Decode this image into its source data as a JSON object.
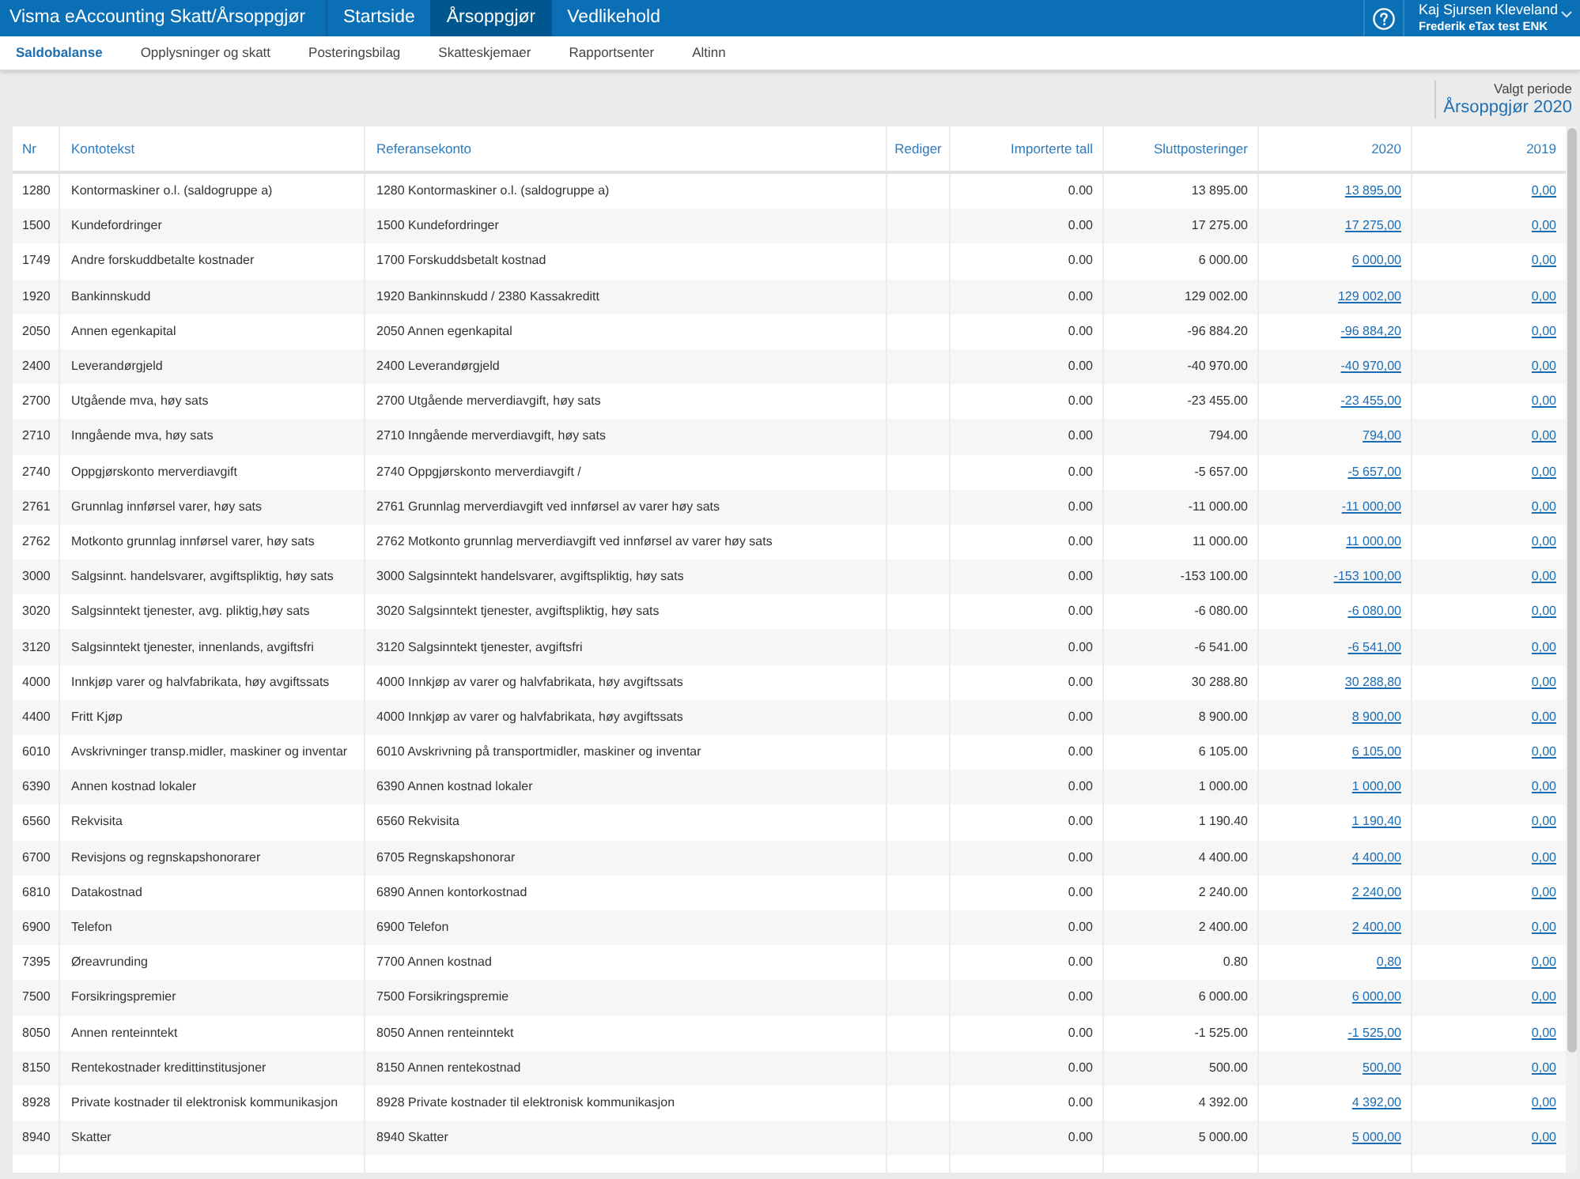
{
  "app_bar": {
    "title": "Visma eAccounting Skatt/Årsoppgjør",
    "nav": [
      {
        "label": "Startside",
        "selected": false
      },
      {
        "label": "Årsoppgjør",
        "selected": true
      },
      {
        "label": "Vedlikehold",
        "selected": false
      }
    ],
    "user": {
      "name": "Kaj Sjursen Kleveland",
      "company": "Frederik eTax test ENK"
    }
  },
  "sub_nav": [
    {
      "label": "Saldobalanse",
      "selected": true
    },
    {
      "label": "Opplysninger og skatt",
      "selected": false
    },
    {
      "label": "Posteringsbilag",
      "selected": false
    },
    {
      "label": "Skatteskjemaer",
      "selected": false
    },
    {
      "label": "Rapportsenter",
      "selected": false
    },
    {
      "label": "Altinn",
      "selected": false
    }
  ],
  "period": {
    "label": "Valgt periode",
    "value": "Årsoppgjør 2020"
  },
  "table": {
    "columns": [
      "Nr",
      "Kontotekst",
      "Referansekonto",
      "Rediger",
      "Importerte tall",
      "Sluttposteringer",
      "2020",
      "2019"
    ],
    "rows": [
      {
        "nr": "1280",
        "account_text": "Kontormaskiner o.l. (saldogruppe a)",
        "reference_account": "1280 Kontormaskiner o.l. (saldogruppe a)",
        "imported": "0.00",
        "final_entries": "13 895.00",
        "amount_2020": "13 895,00",
        "amount_2019": "0,00"
      },
      {
        "nr": "1500",
        "account_text": "Kundefordringer",
        "reference_account": "1500 Kundefordringer",
        "imported": "0.00",
        "final_entries": "17 275.00",
        "amount_2020": "17 275,00",
        "amount_2019": "0,00"
      },
      {
        "nr": "1749",
        "account_text": "Andre forskuddbetalte kostnader",
        "reference_account": "1700 Forskuddsbetalt kostnad",
        "imported": "0.00",
        "final_entries": "6 000.00",
        "amount_2020": "6 000,00",
        "amount_2019": "0,00"
      },
      {
        "nr": "1920",
        "account_text": "Bankinnskudd",
        "reference_account": "1920 Bankinnskudd / 2380 Kassakreditt",
        "imported": "0.00",
        "final_entries": "129 002.00",
        "amount_2020": "129 002,00",
        "amount_2019": "0,00"
      },
      {
        "nr": "2050",
        "account_text": "Annen egenkapital",
        "reference_account": "2050 Annen egenkapital",
        "imported": "0.00",
        "final_entries": "-96 884.20",
        "amount_2020": "-96 884,20",
        "amount_2019": "0,00"
      },
      {
        "nr": "2400",
        "account_text": "Leverandørgjeld",
        "reference_account": "2400 Leverandørgjeld",
        "imported": "0.00",
        "final_entries": "-40 970.00",
        "amount_2020": "-40 970,00",
        "amount_2019": "0,00"
      },
      {
        "nr": "2700",
        "account_text": "Utgående mva, høy sats",
        "reference_account": "2700 Utgående merverdiavgift, høy sats",
        "imported": "0.00",
        "final_entries": "-23 455.00",
        "amount_2020": "-23 455,00",
        "amount_2019": "0,00"
      },
      {
        "nr": "2710",
        "account_text": "Inngående mva, høy sats",
        "reference_account": "2710 Inngående merverdiavgift, høy sats",
        "imported": "0.00",
        "final_entries": "794.00",
        "amount_2020": "794,00",
        "amount_2019": "0,00"
      },
      {
        "nr": "2740",
        "account_text": "Oppgjørskonto merverdiavgift",
        "reference_account": "2740 Oppgjørskonto merverdiavgift /",
        "imported": "0.00",
        "final_entries": "-5 657.00",
        "amount_2020": "-5 657,00",
        "amount_2019": "0,00"
      },
      {
        "nr": "2761",
        "account_text": "Grunnlag innførsel varer, høy sats",
        "reference_account": "2761 Grunnlag merverdiavgift ved innførsel av varer høy sats",
        "imported": "0.00",
        "final_entries": "-11 000.00",
        "amount_2020": "-11 000,00",
        "amount_2019": "0,00"
      },
      {
        "nr": "2762",
        "account_text": "Motkonto grunnlag innførsel varer, høy sats",
        "reference_account": "2762 Motkonto grunnlag merverdiavgift ved innførsel av varer høy sats",
        "imported": "0.00",
        "final_entries": "11 000.00",
        "amount_2020": "11 000,00",
        "amount_2019": "0,00"
      },
      {
        "nr": "3000",
        "account_text": "Salgsinnt. handelsvarer, avgiftspliktig, høy sats",
        "reference_account": "3000 Salgsinntekt handelsvarer, avgiftspliktig, høy sats",
        "imported": "0.00",
        "final_entries": "-153 100.00",
        "amount_2020": "-153 100,00",
        "amount_2019": "0,00"
      },
      {
        "nr": "3020",
        "account_text": "Salgsinntekt tjenester, avg. pliktig,høy sats",
        "reference_account": "3020 Salgsinntekt tjenester, avgiftspliktig, høy sats",
        "imported": "0.00",
        "final_entries": "-6 080.00",
        "amount_2020": "-6 080,00",
        "amount_2019": "0,00"
      },
      {
        "nr": "3120",
        "account_text": "Salgsinntekt tjenester, innenlands, avgiftsfri",
        "reference_account": "3120 Salgsinntekt tjenester, avgiftsfri",
        "imported": "0.00",
        "final_entries": "-6 541.00",
        "amount_2020": "-6 541,00",
        "amount_2019": "0,00"
      },
      {
        "nr": "4000",
        "account_text": "Innkjøp varer og halvfabrikata, høy avgiftssats",
        "reference_account": "4000 Innkjøp av varer og halvfabrikata, høy avgiftssats",
        "imported": "0.00",
        "final_entries": "30 288.80",
        "amount_2020": "30 288,80",
        "amount_2019": "0,00"
      },
      {
        "nr": "4400",
        "account_text": "Fritt Kjøp",
        "reference_account": "4000 Innkjøp av varer og halvfabrikata, høy avgiftssats",
        "imported": "0.00",
        "final_entries": "8 900.00",
        "amount_2020": "8 900,00",
        "amount_2019": "0,00"
      },
      {
        "nr": "6010",
        "account_text": "Avskrivninger transp.midler, maskiner og inventar",
        "reference_account": "6010 Avskrivning på transportmidler, maskiner og inventar",
        "imported": "0.00",
        "final_entries": "6 105.00",
        "amount_2020": "6 105,00",
        "amount_2019": "0,00"
      },
      {
        "nr": "6390",
        "account_text": "Annen kostnad lokaler",
        "reference_account": "6390 Annen kostnad lokaler",
        "imported": "0.00",
        "final_entries": "1 000.00",
        "amount_2020": "1 000,00",
        "amount_2019": "0,00"
      },
      {
        "nr": "6560",
        "account_text": "Rekvisita",
        "reference_account": "6560 Rekvisita",
        "imported": "0.00",
        "final_entries": "1 190.40",
        "amount_2020": "1 190,40",
        "amount_2019": "0,00"
      },
      {
        "nr": "6700",
        "account_text": "Revisjons og regnskapshonorarer",
        "reference_account": "6705 Regnskapshonorar",
        "imported": "0.00",
        "final_entries": "4 400.00",
        "amount_2020": "4 400,00",
        "amount_2019": "0,00"
      },
      {
        "nr": "6810",
        "account_text": "Datakostnad",
        "reference_account": "6890 Annen kontorkostnad",
        "imported": "0.00",
        "final_entries": "2 240.00",
        "amount_2020": "2 240,00",
        "amount_2019": "0,00"
      },
      {
        "nr": "6900",
        "account_text": "Telefon",
        "reference_account": "6900 Telefon",
        "imported": "0.00",
        "final_entries": "2 400.00",
        "amount_2020": "2 400,00",
        "amount_2019": "0,00"
      },
      {
        "nr": "7395",
        "account_text": "Øreavrunding",
        "reference_account": "7700 Annen kostnad",
        "imported": "0.00",
        "final_entries": "0.80",
        "amount_2020": "0,80",
        "amount_2019": "0,00"
      },
      {
        "nr": "7500",
        "account_text": "Forsikringspremier",
        "reference_account": "7500 Forsikringspremie",
        "imported": "0.00",
        "final_entries": "6 000.00",
        "amount_2020": "6 000,00",
        "amount_2019": "0,00"
      },
      {
        "nr": "8050",
        "account_text": "Annen renteinntekt",
        "reference_account": "8050 Annen renteinntekt",
        "imported": "0.00",
        "final_entries": "-1 525.00",
        "amount_2020": "-1 525,00",
        "amount_2019": "0,00"
      },
      {
        "nr": "8150",
        "account_text": "Rentekostnader kredittinstitusjoner",
        "reference_account": "8150 Annen rentekostnad",
        "imported": "0.00",
        "final_entries": "500.00",
        "amount_2020": "500,00",
        "amount_2019": "0,00"
      },
      {
        "nr": "8928",
        "account_text": "Private kostnader til elektronisk kommunikasjon",
        "reference_account": "8928 Private kostnader til elektronisk kommunikasjon",
        "imported": "0.00",
        "final_entries": "4 392.00",
        "amount_2020": "4 392,00",
        "amount_2019": "0,00"
      },
      {
        "nr": "8940",
        "account_text": "Skatter",
        "reference_account": "8940 Skatter",
        "imported": "0.00",
        "final_entries": "5 000.00",
        "amount_2020": "5 000,00",
        "amount_2019": "0,00"
      }
    ]
  }
}
